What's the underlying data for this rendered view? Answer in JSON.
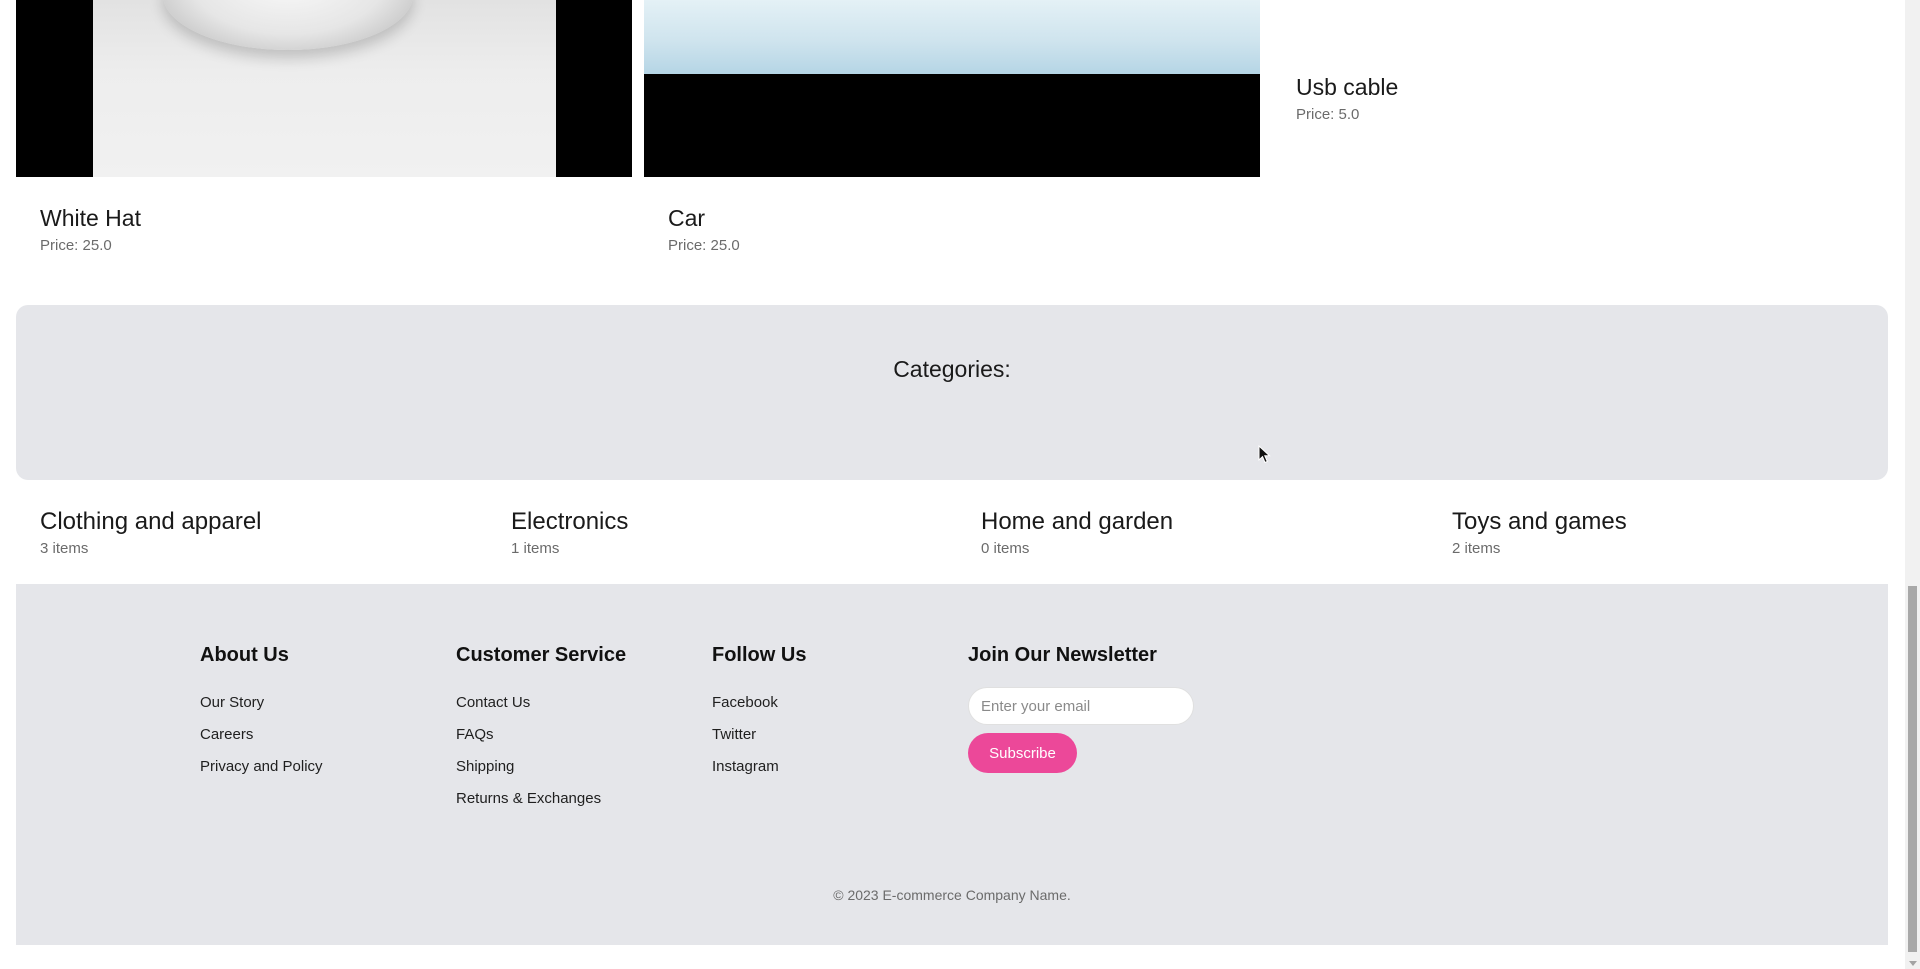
{
  "products": [
    {
      "name": "White Hat",
      "price": "Price: 25.0",
      "image": "white-hat-photo"
    },
    {
      "name": "Car",
      "price": "Price: 25.0",
      "image": "car-photo"
    },
    {
      "name": "Usb cable",
      "price": "Price: 5.0",
      "image": null
    }
  ],
  "categories_section": {
    "title": "Categories:",
    "items": [
      {
        "name": "Clothing and apparel",
        "count": "3 items"
      },
      {
        "name": "Electronics",
        "count": "1 items"
      },
      {
        "name": "Home and garden",
        "count": "0 items"
      },
      {
        "name": "Toys and games",
        "count": "2 items"
      }
    ]
  },
  "footer": {
    "about": {
      "heading": "About Us",
      "links": [
        "Our Story",
        "Careers",
        "Privacy and Policy"
      ]
    },
    "customer_service": {
      "heading": "Customer Service",
      "links": [
        "Contact Us",
        "FAQs",
        "Shipping",
        "Returns & Exchanges"
      ]
    },
    "follow": {
      "heading": "Follow Us",
      "links": [
        "Facebook",
        "Twitter",
        "Instagram"
      ]
    },
    "newsletter": {
      "heading": "Join Our Newsletter",
      "email_placeholder": "Enter your email",
      "email_value": "",
      "subscribe_label": "Subscribe"
    },
    "copyright": "© 2023 E-commerce Company Name."
  },
  "colors": {
    "panel_background": "#e5e6ea",
    "accent": "#ec4899",
    "muted_text": "#6b6b6b"
  }
}
